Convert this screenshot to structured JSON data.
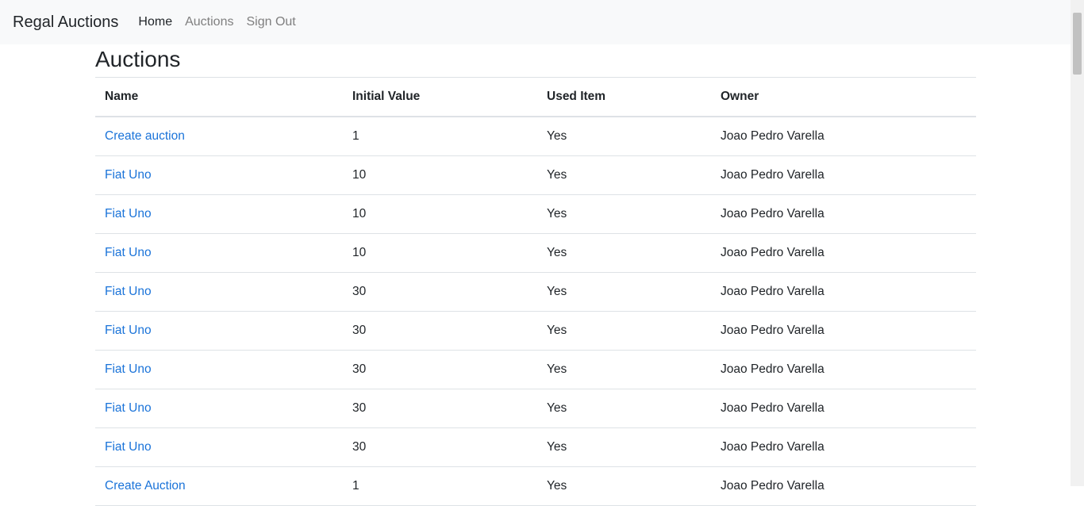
{
  "navbar": {
    "brand": "Regal Auctions",
    "links": [
      {
        "label": "Home",
        "active": true
      },
      {
        "label": "Auctions",
        "active": false
      },
      {
        "label": "Sign Out",
        "active": false
      }
    ]
  },
  "page": {
    "title": "Auctions"
  },
  "table": {
    "headers": [
      "Name",
      "Initial Value",
      "Used Item",
      "Owner"
    ],
    "rows": [
      {
        "name": "Create auction",
        "initial_value": "1",
        "used_item": "Yes",
        "owner": "Joao Pedro Varella"
      },
      {
        "name": "Fiat Uno",
        "initial_value": "10",
        "used_item": "Yes",
        "owner": "Joao Pedro Varella"
      },
      {
        "name": "Fiat Uno",
        "initial_value": "10",
        "used_item": "Yes",
        "owner": "Joao Pedro Varella"
      },
      {
        "name": "Fiat Uno",
        "initial_value": "10",
        "used_item": "Yes",
        "owner": "Joao Pedro Varella"
      },
      {
        "name": "Fiat Uno",
        "initial_value": "30",
        "used_item": "Yes",
        "owner": "Joao Pedro Varella"
      },
      {
        "name": "Fiat Uno",
        "initial_value": "30",
        "used_item": "Yes",
        "owner": "Joao Pedro Varella"
      },
      {
        "name": "Fiat Uno",
        "initial_value": "30",
        "used_item": "Yes",
        "owner": "Joao Pedro Varella"
      },
      {
        "name": "Fiat Uno",
        "initial_value": "30",
        "used_item": "Yes",
        "owner": "Joao Pedro Varella"
      },
      {
        "name": "Fiat Uno",
        "initial_value": "30",
        "used_item": "Yes",
        "owner": "Joao Pedro Varella"
      },
      {
        "name": "Create Auction",
        "initial_value": "1",
        "used_item": "Yes",
        "owner": "Joao Pedro Varella"
      }
    ]
  },
  "colors": {
    "link": "#1a73d9",
    "navbar_bg": "#f8f9fa",
    "nav_inactive": "#7f7f7f"
  }
}
